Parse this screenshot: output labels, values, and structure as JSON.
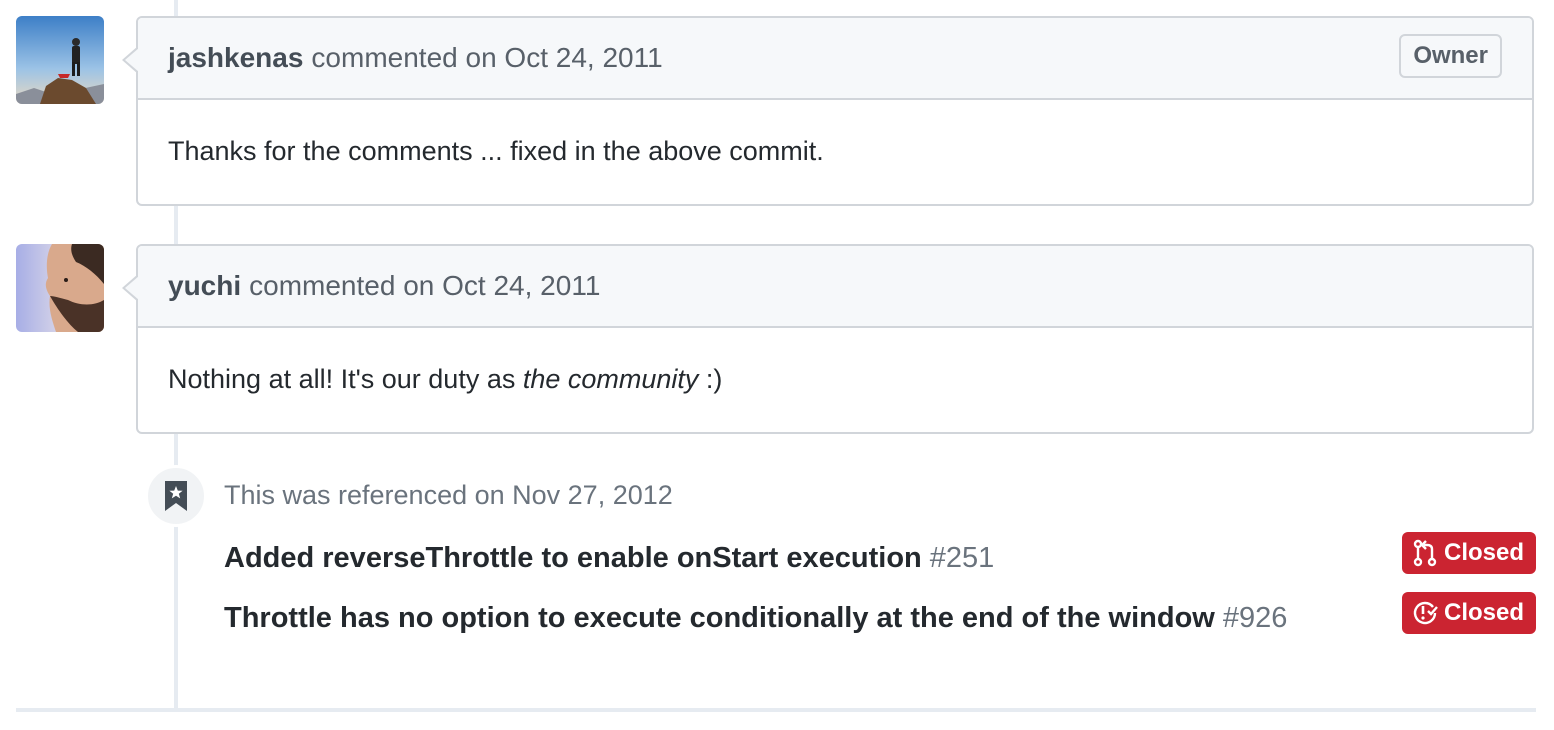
{
  "comments": [
    {
      "author": "jashkenas",
      "meta": "commented on Oct 24, 2011",
      "badge": "Owner",
      "body": "Thanks for the comments ... fixed in the above commit."
    },
    {
      "author": "yuchi",
      "meta": "commented on Oct 24, 2011",
      "body_before": "Nothing at all! It's our duty as ",
      "body_em": "the community",
      "body_after": " :)"
    }
  ],
  "reference_event": {
    "icon": "bookmark-icon",
    "title": "This was referenced on Nov 27, 2012",
    "items": [
      {
        "title": "Added reverseThrottle to enable onStart execution",
        "number": "#251",
        "state": "Closed",
        "state_icon": "git-pull-request-icon",
        "state_color": "#cb2431"
      },
      {
        "title": "Throttle has no option to execute conditionally at the end of the window",
        "number": "#926",
        "state": "Closed",
        "state_icon": "issue-closed-icon",
        "state_color": "#cb2431"
      }
    ]
  }
}
